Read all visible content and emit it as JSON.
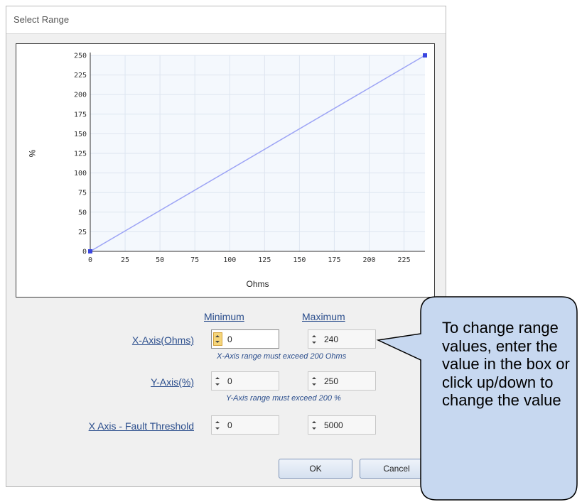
{
  "dialog": {
    "title": "Select Range"
  },
  "chart_data": {
    "type": "line",
    "xlabel": "Ohms",
    "ylabel": "%",
    "xlim": [
      0,
      240
    ],
    "ylim": [
      0,
      250
    ],
    "x_ticks": [
      0,
      25,
      50,
      75,
      100,
      125,
      150,
      175,
      200,
      225
    ],
    "y_ticks": [
      0,
      25,
      50,
      75,
      100,
      125,
      150,
      175,
      200,
      225,
      250
    ],
    "grid": true,
    "line_color": "#9da4f5",
    "marker_color": "#3a46e0",
    "series": [
      {
        "x": [
          0,
          240
        ],
        "y": [
          0,
          250
        ]
      }
    ]
  },
  "form": {
    "min_header": "Minimum",
    "max_header": "Maximum",
    "rows": [
      {
        "label": "X-Axis(Ohms)",
        "min": "0",
        "max": "240",
        "hint": "X-Axis range must exceed 200 Ohms"
      },
      {
        "label": "Y-Axis(%)",
        "min": "0",
        "max": "250",
        "hint": "Y-Axis range must exceed 200 %"
      },
      {
        "label": "X Axis - Fault Threshold",
        "min": "0",
        "max": "5000"
      }
    ]
  },
  "buttons": {
    "ok": "OK",
    "cancel": "Cancel"
  },
  "callout": {
    "text": "To change range values, enter the value in the box or click up/down to change the value"
  }
}
